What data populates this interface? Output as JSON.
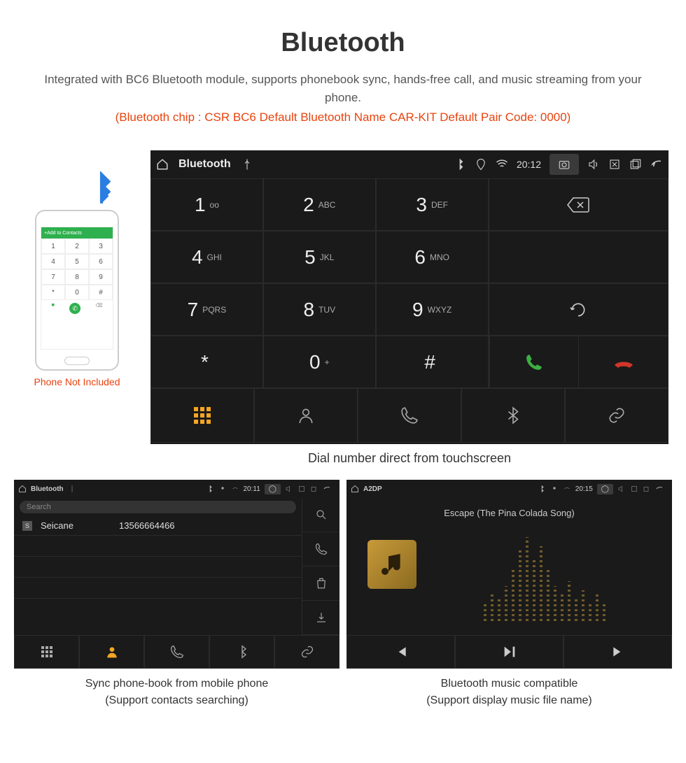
{
  "header": {
    "title": "Bluetooth",
    "description": "Integrated with BC6 Bluetooth module, supports phonebook sync, hands-free call, and music streaming from your phone.",
    "spec": "(Bluetooth chip : CSR BC6    Default Bluetooth Name CAR-KIT    Default Pair Code: 0000)"
  },
  "phone_illustration": {
    "topbar_text": "Add to Contacts",
    "keys": [
      "1",
      "2",
      "3",
      "4",
      "5",
      "6",
      "7",
      "8",
      "9",
      "*",
      "0",
      "#"
    ],
    "caption": "Phone Not Included"
  },
  "main_dialer": {
    "topbar": {
      "title": "Bluetooth",
      "time": "20:12"
    },
    "keys": [
      {
        "num": "1",
        "sub": "oo"
      },
      {
        "num": "2",
        "sub": "ABC"
      },
      {
        "num": "3",
        "sub": "DEF"
      },
      {
        "num": "4",
        "sub": "GHI"
      },
      {
        "num": "5",
        "sub": "JKL"
      },
      {
        "num": "6",
        "sub": "MNO"
      },
      {
        "num": "7",
        "sub": "PQRS"
      },
      {
        "num": "8",
        "sub": "TUV"
      },
      {
        "num": "9",
        "sub": "WXYZ"
      },
      {
        "num": "*",
        "sub": ""
      },
      {
        "num": "0",
        "sub": "+"
      },
      {
        "num": "#",
        "sub": ""
      }
    ],
    "caption": "Dial number direct from touchscreen"
  },
  "contacts_screen": {
    "topbar": {
      "title": "Bluetooth",
      "time": "20:11"
    },
    "search_placeholder": "Search",
    "contact": {
      "initial": "S",
      "name": "Seicane",
      "number": "13566664466"
    },
    "caption_line1": "Sync phone-book from mobile phone",
    "caption_line2": "(Support contacts searching)"
  },
  "a2dp_screen": {
    "topbar": {
      "title": "A2DP",
      "time": "20:15"
    },
    "track_title": "Escape (The Pina Colada Song)",
    "caption_line1": "Bluetooth music compatible",
    "caption_line2": "(Support display music file name)"
  }
}
